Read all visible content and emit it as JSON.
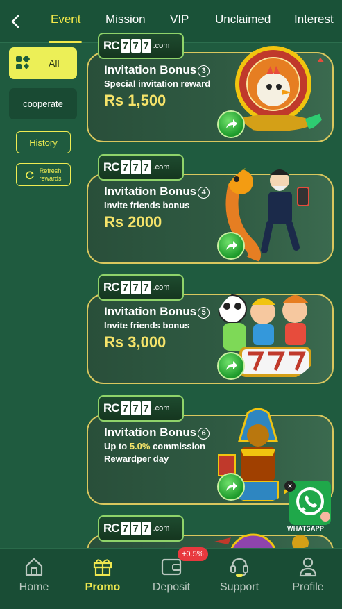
{
  "header": {
    "tabs": [
      {
        "label": "Event",
        "active": true
      },
      {
        "label": "Mission"
      },
      {
        "label": "VIP"
      },
      {
        "label": "Unclaimed"
      },
      {
        "label": "Interest"
      }
    ]
  },
  "sidebar": {
    "all_label": "All",
    "cooperate_label": "cooperate",
    "history_label": "History",
    "refresh_label_line1": "Refresh",
    "refresh_label_line2": "rewards"
  },
  "cards": [
    {
      "logo_rc": "RC",
      "logo_digits": [
        "7",
        "7",
        "7"
      ],
      "logo_com": ".com",
      "title": "Invitation Bonus",
      "num": "3",
      "subtitle": "Special invitation reward",
      "amount": "Rs 1,500"
    },
    {
      "logo_rc": "RC",
      "logo_digits": [
        "7",
        "7",
        "7"
      ],
      "logo_com": ".com",
      "title": "Invitation Bonus",
      "num": "4",
      "subtitle": "Invite friends bonus",
      "amount": "Rs 2000"
    },
    {
      "logo_rc": "RC",
      "logo_digits": [
        "7",
        "7",
        "7"
      ],
      "logo_com": ".com",
      "title": "Invitation Bonus",
      "num": "5",
      "subtitle": "Invite friends bonus",
      "amount": "Rs 3,000"
    },
    {
      "logo_rc": "RC",
      "logo_digits": [
        "7",
        "7",
        "7"
      ],
      "logo_com": ".com",
      "title": "Invitation Bonus",
      "num": "6",
      "subtitle_prefix": "Up to ",
      "subtitle_highlight": "5.0%",
      "subtitle_suffix": " commission",
      "subtitle2": "Rewardper day"
    },
    {
      "logo_rc": "RC",
      "logo_digits": [
        "7",
        "7",
        "7"
      ],
      "logo_com": ".com"
    }
  ],
  "whatsapp": {
    "label": "WHATSAPP",
    "close": "×"
  },
  "bottom_nav": {
    "items": [
      {
        "label": "Home",
        "icon": "home-icon"
      },
      {
        "label": "Promo",
        "icon": "gift-icon",
        "active": true
      },
      {
        "label": "Deposit",
        "icon": "wallet-icon"
      },
      {
        "label": "Support",
        "icon": "headset-icon"
      },
      {
        "label": "Profile",
        "icon": "profile-icon"
      }
    ],
    "deposit_badge": "+0.5%"
  },
  "colors": {
    "background": "#1f5b3f",
    "accent_yellow": "#f2e94a",
    "card_border": "#d9c75e",
    "amount_gold": "#f5e36a",
    "badge_red": "#e8383e"
  }
}
